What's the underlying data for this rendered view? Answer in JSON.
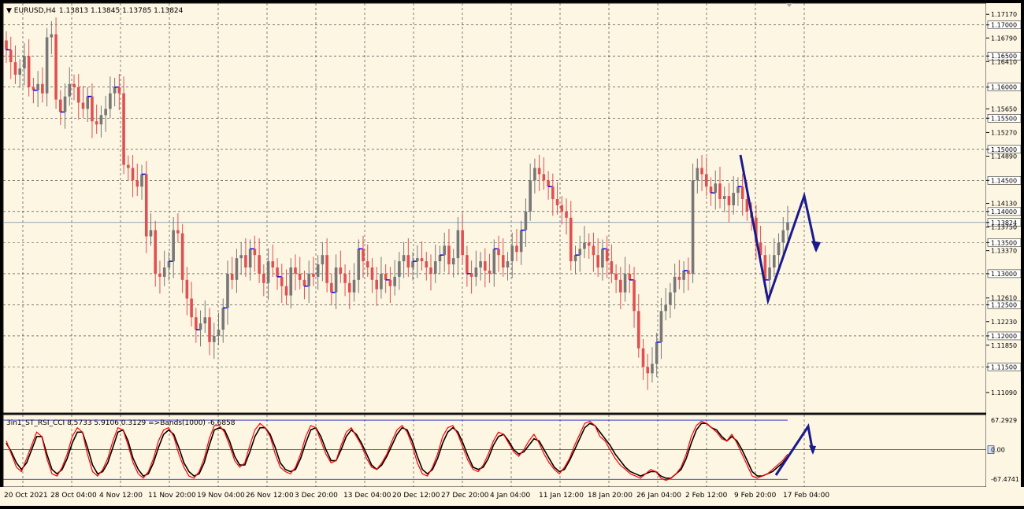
{
  "header": {
    "symbol": "EURUSD,H4",
    "ohlc": "1.13813 1.13845 1.13785 1.13824"
  },
  "colors": {
    "background": "#fdf6e3",
    "grid": "#333333",
    "bull_candle": "#777777",
    "bear_candle": "#e05050",
    "level_mark": "#0000ff",
    "arrow": "#1a1a8c",
    "band": "#1a1acc",
    "cci_fast": "#ff0000",
    "cci_slow": "#000000",
    "highlight_label": "#ffffff"
  },
  "chart_data": [
    {
      "type": "candlestick",
      "name": "EURUSD,H4",
      "ylim": [
        1.1076,
        1.1735
      ],
      "price_labels": [
        "1.17170",
        "1.17000",
        "1.16790",
        "1.16500",
        "1.16410",
        "1.16000",
        "1.15650",
        "1.15500",
        "1.15270",
        "1.15000",
        "1.14890",
        "1.14500",
        "1.14130",
        "1.14000",
        "1.13824",
        "1.13750",
        "1.13500",
        "1.13370",
        "1.13000",
        "1.12610",
        "1.12500",
        "1.12230",
        "1.12000",
        "1.11850",
        "1.11500",
        "1.11090"
      ],
      "highlighted_levels": [
        "1.17000",
        "1.16500",
        "1.16000",
        "1.15500",
        "1.15000",
        "1.14500",
        "1.14000",
        "1.13824",
        "1.13500",
        "1.13000",
        "1.12500",
        "1.12000",
        "1.11500"
      ],
      "current_price": 1.13824,
      "time_labels": [
        "20 Oct 2021",
        "28 Oct 04:00",
        "4 Nov 12:00",
        "11 Nov 20:00",
        "19 Nov 04:00",
        "26 Nov 12:00",
        "3 Dec 20:00",
        "13 Dec 04:00",
        "20 Dec 12:00",
        "27 Dec 20:00",
        "4 Jan 04:00",
        "11 Jan 12:00",
        "18 Jan 20:00",
        "26 Jan 04:00",
        "2 Feb 12:00",
        "9 Feb 20:00",
        "17 Feb 04:00"
      ],
      "closes": [
        1.166,
        1.164,
        1.162,
        1.163,
        1.165,
        1.16,
        1.1595,
        1.1605,
        1.159,
        1.168,
        1.1685,
        1.158,
        1.156,
        1.1585,
        1.1605,
        1.16,
        1.1575,
        1.1565,
        1.1585,
        1.1545,
        1.154,
        1.1555,
        1.1565,
        1.159,
        1.16,
        1.159,
        1.1475,
        1.147,
        1.145,
        1.144,
        1.146,
        1.136,
        1.137,
        1.13,
        1.1295,
        1.131,
        1.132,
        1.137,
        1.1365,
        1.129,
        1.126,
        1.123,
        1.121,
        1.122,
        1.123,
        1.119,
        1.12,
        1.121,
        1.1245,
        1.13,
        1.129,
        1.1325,
        1.133,
        1.131,
        1.134,
        1.133,
        1.13,
        1.1285,
        1.132,
        1.131,
        1.1295,
        1.128,
        1.1265,
        1.131,
        1.13,
        1.129,
        1.128,
        1.13,
        1.1295,
        1.1315,
        1.133,
        1.1285,
        1.127,
        1.131,
        1.13,
        1.1285,
        1.127,
        1.129,
        1.134,
        1.132,
        1.131,
        1.129,
        1.1275,
        1.13,
        1.129,
        1.128,
        1.1295,
        1.132,
        1.133,
        1.131,
        1.132,
        1.1325,
        1.132,
        1.131,
        1.13,
        1.132,
        1.133,
        1.1345,
        1.1315,
        1.1325,
        1.137,
        1.133,
        1.13,
        1.1295,
        1.131,
        1.132,
        1.1305,
        1.13,
        1.134,
        1.133,
        1.131,
        1.132,
        1.1345,
        1.1335,
        1.137,
        1.14,
        1.145,
        1.147,
        1.146,
        1.145,
        1.144,
        1.142,
        1.141,
        1.14,
        1.139,
        1.132,
        1.133,
        1.134,
        1.135,
        1.1345,
        1.133,
        1.131,
        1.134,
        1.132,
        1.13,
        1.129,
        1.127,
        1.13,
        1.129,
        1.124,
        1.118,
        1.115,
        1.114,
        1.1155,
        1.119,
        1.124,
        1.125,
        1.127,
        1.1295,
        1.129,
        1.1305,
        1.13,
        1.145,
        1.147,
        1.146,
        1.144,
        1.143,
        1.1445,
        1.142,
        1.1425,
        1.141,
        1.143,
        1.144,
        1.142,
        1.14,
        1.139,
        1.135,
        1.133,
        1.129,
        1.131,
        1.133,
        1.135,
        1.137,
        1.1382
      ]
    },
    {
      "type": "line",
      "name": "3in1_ST_RSI_CCI",
      "label": "3in1_ST_RSI_CCI 8.5733 5.9106 0.3129 =>Bands(1000) -6.6858",
      "ylim": [
        -85,
        80
      ],
      "level_labels": [
        "67.2929",
        "0.00",
        "-67.4741"
      ],
      "zero_label": "0.00",
      "series_fast": [
        20,
        -10,
        -40,
        -50,
        -20,
        10,
        40,
        30,
        -20,
        -55,
        -60,
        -40,
        -10,
        30,
        50,
        40,
        -10,
        -50,
        -60,
        -45,
        -20,
        20,
        50,
        45,
        10,
        -30,
        -55,
        -65,
        -50,
        -20,
        20,
        45,
        50,
        30,
        -10,
        -40,
        -60,
        -65,
        -50,
        -20,
        25,
        55,
        55,
        40,
        10,
        -25,
        -40,
        -30,
        10,
        45,
        60,
        50,
        30,
        -10,
        -40,
        -50,
        -55,
        -40,
        -10,
        30,
        55,
        50,
        20,
        -10,
        -30,
        -25,
        10,
        40,
        50,
        30,
        10,
        -20,
        -40,
        -45,
        -30,
        -10,
        20,
        45,
        55,
        40,
        10,
        -30,
        -55,
        -60,
        -40,
        -10,
        30,
        50,
        55,
        35,
        5,
        -25,
        -45,
        -50,
        -35,
        -10,
        20,
        40,
        35,
        15,
        -5,
        -15,
        0,
        20,
        35,
        15,
        -10,
        -30,
        -45,
        -55,
        -40,
        -20,
        10,
        35,
        60,
        65,
        55,
        30,
        20,
        0,
        -20,
        -35,
        -45,
        -55,
        -60,
        -65,
        -55,
        -45,
        -50,
        -65,
        -70,
        -65,
        -55,
        -40,
        -10,
        30,
        55,
        65,
        60,
        50,
        40,
        25,
        20,
        35,
        15,
        -10,
        -35,
        -60,
        -65,
        -60,
        -55,
        -45,
        -35,
        -25,
        -10
      ],
      "series_slow": [
        15,
        -5,
        -30,
        -45,
        -30,
        0,
        30,
        30,
        -10,
        -45,
        -55,
        -45,
        -20,
        15,
        40,
        40,
        5,
        -35,
        -55,
        -50,
        -30,
        5,
        40,
        45,
        20,
        -20,
        -45,
        -60,
        -55,
        -30,
        5,
        35,
        45,
        35,
        5,
        -30,
        -50,
        -60,
        -55,
        -30,
        10,
        45,
        50,
        45,
        20,
        -15,
        -35,
        -35,
        -5,
        30,
        50,
        50,
        35,
        5,
        -30,
        -45,
        -50,
        -45,
        -20,
        15,
        45,
        50,
        30,
        0,
        -25,
        -25,
        0,
        30,
        45,
        35,
        15,
        -10,
        -35,
        -45,
        -35,
        -15,
        10,
        35,
        50,
        45,
        20,
        -15,
        -45,
        -55,
        -45,
        -20,
        15,
        40,
        50,
        40,
        15,
        -15,
        -40,
        -45,
        -40,
        -20,
        10,
        30,
        35,
        20,
        0,
        -10,
        -5,
        10,
        25,
        20,
        0,
        -20,
        -40,
        -50,
        -45,
        -25,
        0,
        25,
        50,
        60,
        55,
        40,
        25,
        10,
        -10,
        -25,
        -40,
        -50,
        -55,
        -60,
        -55,
        -50,
        -50,
        -60,
        -65,
        -65,
        -55,
        -45,
        -20,
        15,
        45,
        60,
        60,
        50,
        45,
        30,
        20,
        30,
        20,
        0,
        -25,
        -50,
        -60,
        -60,
        -55,
        -50,
        -40,
        -30,
        -15
      ]
    }
  ]
}
